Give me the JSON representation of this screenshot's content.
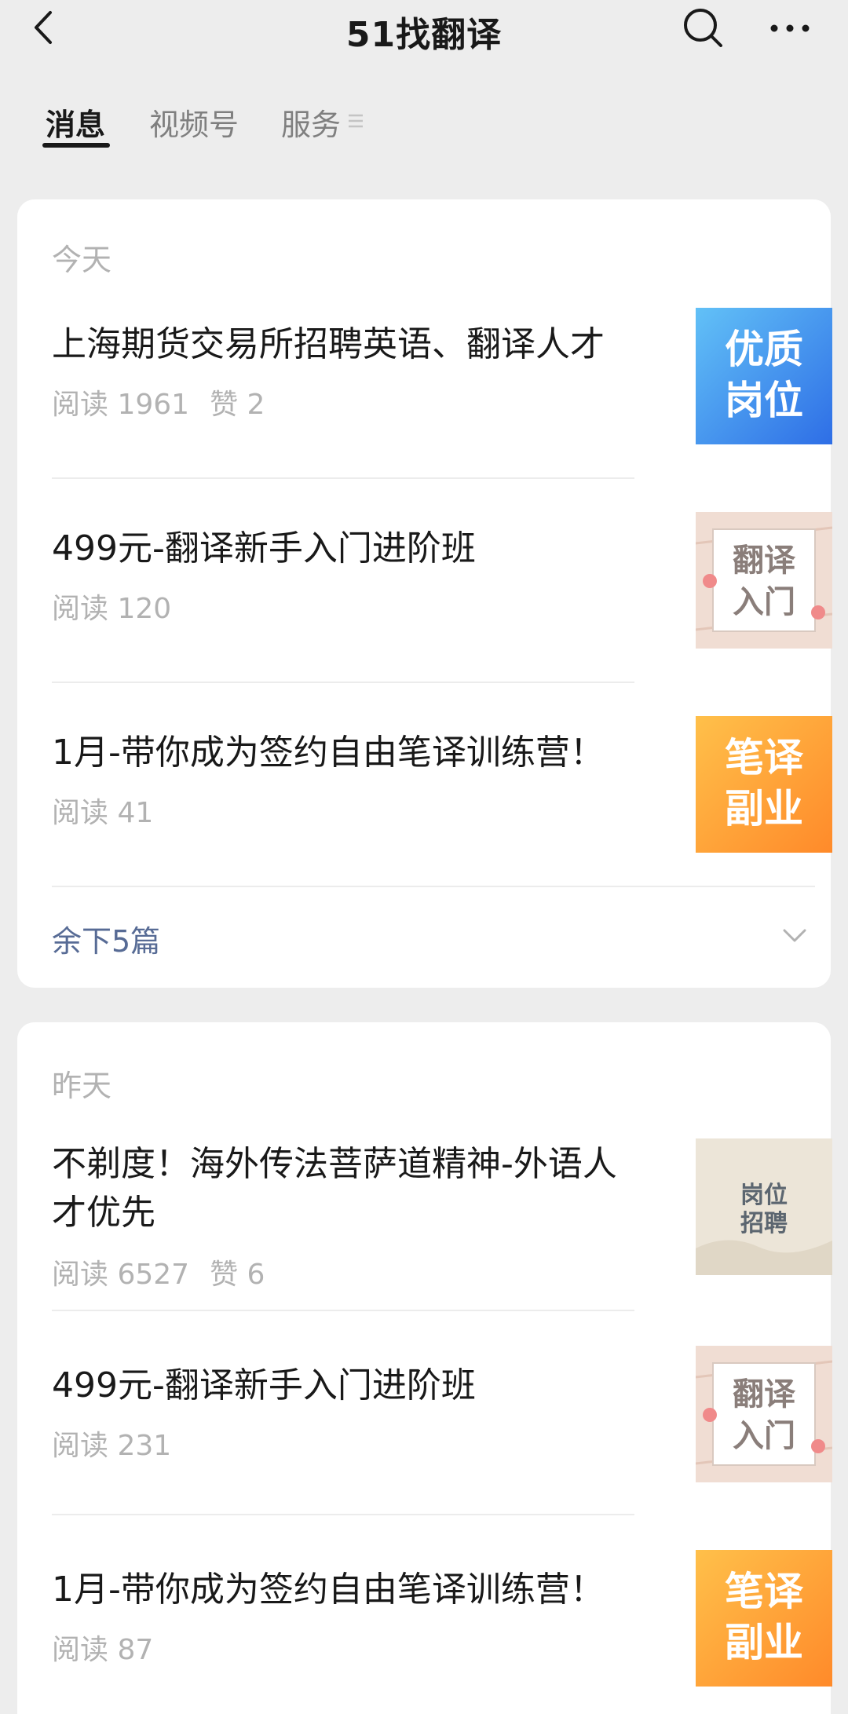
{
  "header": {
    "title": "51找翻译",
    "icons": [
      "back-icon",
      "search-icon",
      "more-icon"
    ]
  },
  "tabs": [
    {
      "label": "消息",
      "active": true
    },
    {
      "label": "视频号",
      "active": false
    },
    {
      "label": "服务",
      "active": false
    }
  ],
  "groups": [
    {
      "date": "今天",
      "articles": [
        {
          "title": "上海期货交易所招聘英语、翻译人才",
          "reads": "阅读 1961",
          "likes": "赞 2",
          "thumb_text": [
            "优质",
            "岗位"
          ]
        },
        {
          "title": "499元-翻译新手入门进阶班",
          "reads": "阅读 120",
          "thumb_text": [
            "翻译",
            "入门"
          ]
        },
        {
          "title": "1月-带你成为签约自由笔译训练营！",
          "reads": "阅读 41",
          "thumb_text": [
            "笔译",
            "副业"
          ]
        }
      ],
      "more": "余下5篇"
    },
    {
      "date": "昨天",
      "articles": [
        {
          "title": "不剃度！海外传法菩萨道精神-外语人才优先",
          "reads": "阅读 6527",
          "likes": "赞 6",
          "thumb_text": [
            "岗位",
            "招聘"
          ]
        },
        {
          "title": "499元-翻译新手入门进阶班",
          "reads": "阅读 231",
          "thumb_text": [
            "翻译",
            "入门"
          ]
        },
        {
          "title": "1月-带你成为签约自由笔译训练营！",
          "reads": "阅读 87",
          "thumb_text": [
            "笔译",
            "副业"
          ]
        }
      ]
    }
  ],
  "colors": {
    "background": "#ededed",
    "card": "#ffffff",
    "link": "#576b95",
    "muted": "#b2b2b2",
    "thumb_blue": "#3a86ef",
    "thumb_orange": "#ff9a2e",
    "thumb_beige": "#ece5d8"
  }
}
